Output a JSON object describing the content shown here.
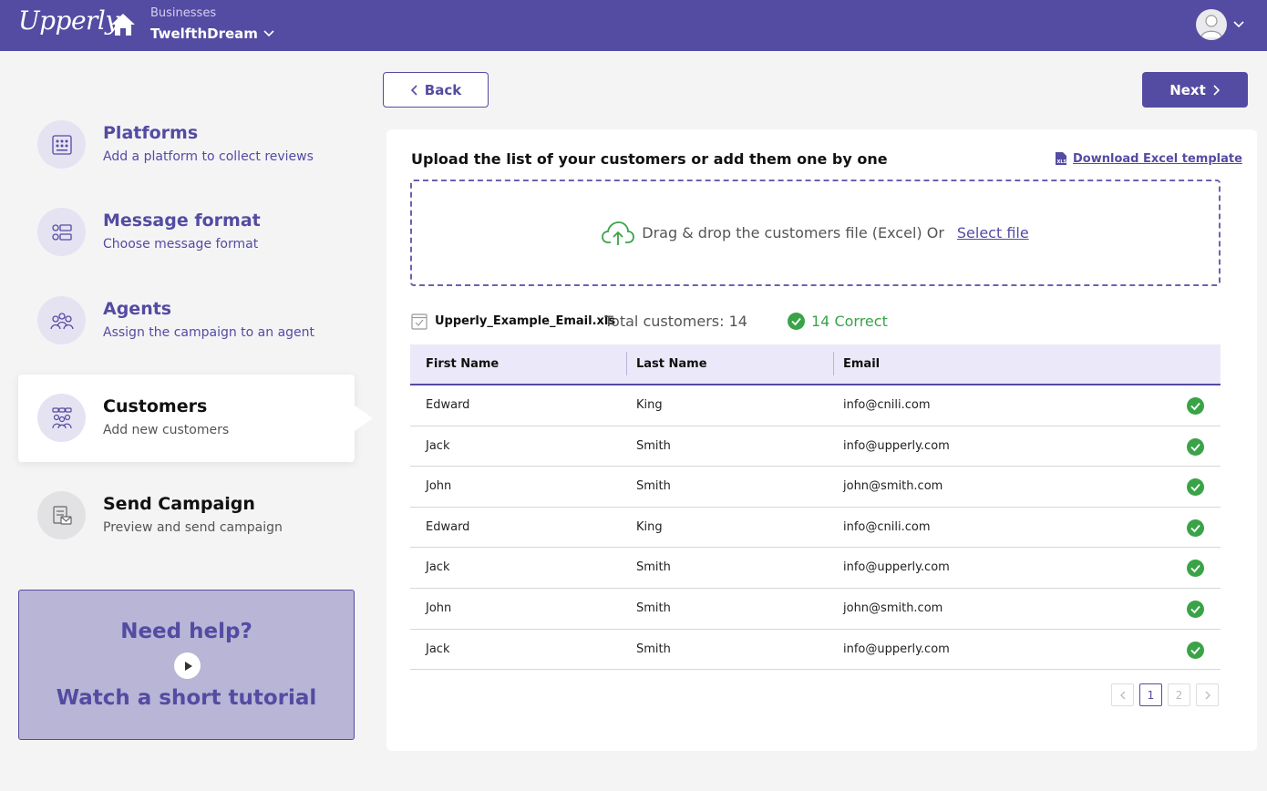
{
  "header": {
    "logo": "Upperly",
    "businesses_caption": "Businesses",
    "business_name": "TwelfthDream"
  },
  "colors": {
    "brand": "#544ba2",
    "success": "#3aa348"
  },
  "nav": {
    "back_label": "Back",
    "next_label": "Next"
  },
  "steps": [
    {
      "title": "Platforms",
      "sub": "Add a platform to collect reviews",
      "icon": "platforms-icon"
    },
    {
      "title": "Message format",
      "sub": "Choose message format",
      "icon": "message-format-icon"
    },
    {
      "title": "Agents",
      "sub": "Assign the campaign to an agent",
      "icon": "agents-icon"
    },
    {
      "title": "Customers",
      "sub": "Add new customers",
      "icon": "customers-icon"
    },
    {
      "title": "Send Campaign",
      "sub": "Preview and send campaign",
      "icon": "send-campaign-icon"
    }
  ],
  "help": {
    "title": "Need help?",
    "subtitle": "Watch a short tutorial"
  },
  "upload": {
    "title": "Upload the list of your customers or add them one by one",
    "download_label": "Download Excel template",
    "drop_text": "Drag & drop the customers file (Excel) Or",
    "select_label": "Select file"
  },
  "file": {
    "name": "Upperly_Example_Email.xls",
    "total": "Total customers: 14",
    "correct": "14 Correct"
  },
  "table": {
    "headers": [
      "First Name",
      "Last Name",
      "Email"
    ],
    "rows": [
      [
        "Edward",
        "King",
        "info@cnili.com"
      ],
      [
        "Jack",
        "Smith",
        "info@upperly.com"
      ],
      [
        "John",
        "Smith",
        "john@smith.com"
      ],
      [
        "Edward",
        "King",
        "info@cnili.com"
      ],
      [
        "Jack",
        "Smith",
        "info@upperly.com"
      ],
      [
        "John",
        "Smith",
        "john@smith.com"
      ],
      [
        "Jack",
        "Smith",
        "info@upperly.com"
      ]
    ]
  },
  "pagination": {
    "pages": [
      "1",
      "2"
    ],
    "current": "1"
  }
}
